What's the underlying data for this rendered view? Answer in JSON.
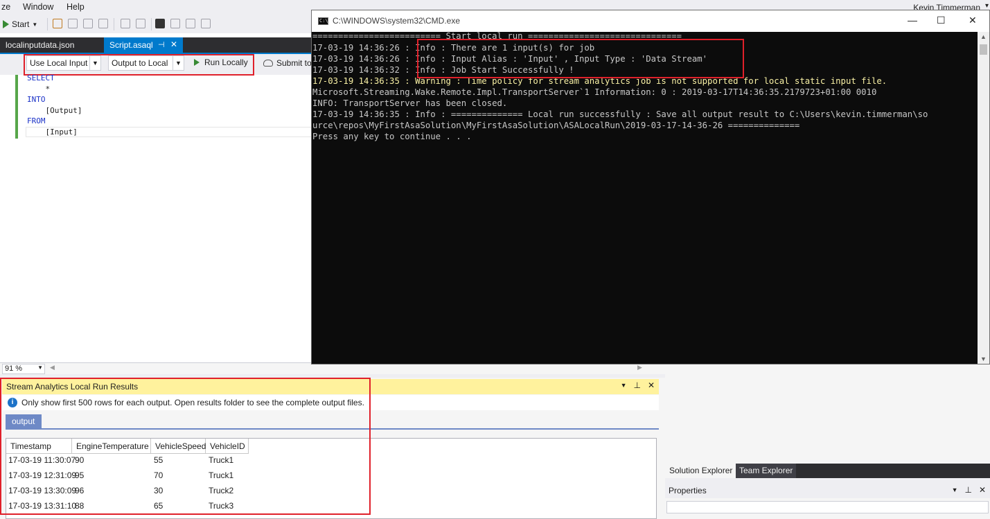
{
  "menu": {
    "items": [
      "ze",
      "Window",
      "Help"
    ],
    "user": "Kevin Timmerman"
  },
  "toolbar": {
    "start_label": "Start"
  },
  "doc_tabs": {
    "tab1": "localinputdata.json",
    "tab2": "Script.asaql"
  },
  "asa_toolbar": {
    "input_combo": "Use Local Input",
    "output_combo": "Output to Local",
    "run_label": "Run Locally",
    "submit_label": "Submit to"
  },
  "code": {
    "lines": [
      "SELECT",
      "    *",
      "INTO",
      "    [Output]",
      "FROM",
      "    [Input]"
    ]
  },
  "zoom": "91 %",
  "results": {
    "title": "Stream Analytics Local Run Results",
    "info": "Only show first 500 rows for each output. Open results folder to see the complete output files.",
    "tab": "output",
    "columns": [
      "Timestamp",
      "EngineTemperature",
      "VehicleSpeed",
      "VehicleID"
    ],
    "rows": [
      [
        "17-03-19 11:30:07",
        "90",
        "55",
        "Truck1"
      ],
      [
        "17-03-19 12:31:09",
        "95",
        "70",
        "Truck1"
      ],
      [
        "17-03-19 13:30:09",
        "96",
        "30",
        "Truck2"
      ],
      [
        "17-03-19 13:31:10",
        "88",
        "65",
        "Truck3"
      ]
    ]
  },
  "solution": {
    "tab_solution": "Solution Explorer",
    "tab_team": "Team Explorer",
    "properties_title": "Properties"
  },
  "cmd": {
    "title": "C:\\WINDOWS\\system32\\CMD.exe",
    "lines": [
      "========================= Start local run ==============================",
      "17-03-19 14:36:26 : Info : There are 1 input(s) for job",
      "17-03-19 14:36:26 : Info : Input Alias : 'Input' , Input Type : 'Data Stream'",
      "17-03-19 14:36:32 : Info : Job Start Successfully !",
      "17-03-19 14:36:35 : Warning : Time policy for stream analytics job is not supported for local static input file.",
      "Microsoft.Streaming.Wake.Remote.Impl.TransportServer`1 Information: 0 : 2019-03-17T14:36:35.2179723+01:00 0010",
      "INFO: TransportServer has been closed.",
      "17-03-19 14:36:35 : Info : ============== Local run successfully : Save all output result to C:\\Users\\kevin.timmerman\\so",
      "urce\\repos\\MyFirstAsaSolution\\MyFirstAsaSolution\\ASALocalRun\\2019-03-17-14-36-26 ==============",
      "Press any key to continue . . ."
    ]
  }
}
